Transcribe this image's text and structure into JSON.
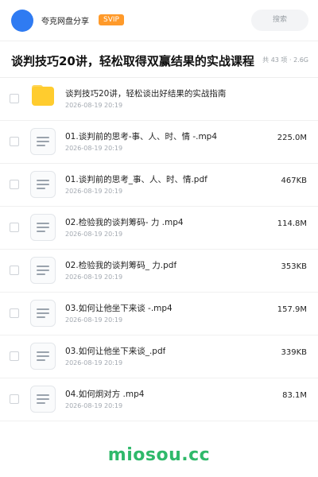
{
  "header": {
    "app_name": "夸克网盘分享",
    "badge": "SVIP",
    "search_placeholder": "搜索",
    "avatar_color": "#2f7bf2",
    "badge_color": "#ff9a2a"
  },
  "share": {
    "title": "谈判技巧20讲，轻松取得双赢结果的实战课程",
    "meta": "共 43 项 · 2.6G"
  },
  "items": [
    {
      "type": "folder",
      "name": "谈判技巧20讲，轻松谈出好结果的实战指南",
      "date": "2026-08-19 20:19",
      "size": ""
    },
    {
      "type": "file",
      "name": "01.谈判前的思考-事、人、时、情 -.mp4",
      "date": "2026-08-19 20:19",
      "size": "225.0M"
    },
    {
      "type": "file",
      "name": "01.谈判前的思考_事、人、时、情.pdf",
      "date": "2026-08-19 20:19",
      "size": "467KB"
    },
    {
      "type": "file",
      "name": "02.检验我的谈判筹码- 力 .mp4",
      "date": "2026-08-19 20:19",
      "size": "114.8M"
    },
    {
      "type": "file",
      "name": "02.检验我的谈判筹码_ 力.pdf",
      "date": "2026-08-19 20:19",
      "size": "353KB"
    },
    {
      "type": "file",
      "name": "03.如何让他坐下来谈 -.mp4",
      "date": "2026-08-19 20:19",
      "size": "157.9M"
    },
    {
      "type": "file",
      "name": "03.如何让他坐下来谈_.pdf",
      "date": "2026-08-19 20:19",
      "size": "339KB"
    },
    {
      "type": "file",
      "name": "04.如何炯对方 .mp4",
      "date": "2026-08-19 20:19",
      "size": "83.1M"
    }
  ],
  "watermark": "miosou.cc",
  "watermark_color": "#2fb96a"
}
